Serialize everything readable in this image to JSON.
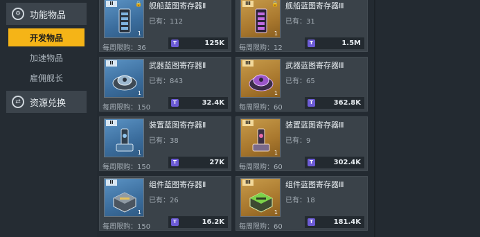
{
  "sidebar": {
    "cat1": {
      "label": "功能物品",
      "icon": "settings-circle-icon"
    },
    "sub1": "开发物品",
    "sub2": "加速物品",
    "sub3": "雇佣舰长",
    "cat2": {
      "label": "资源兑换",
      "icon": "exchange-circle-icon"
    }
  },
  "currency_symbol": "T",
  "items": [
    {
      "tier": "II",
      "name": "舰船蓝图寄存器Ⅱ",
      "owned": "已有：112",
      "limit": "每周限购：36",
      "price": "125K",
      "qty": "1",
      "color": "blue"
    },
    {
      "tier": "III",
      "name": "舰船蓝图寄存器Ⅲ",
      "owned": "已有：31",
      "limit": "每周限购：12",
      "price": "1.5M",
      "qty": "1",
      "color": "gold"
    },
    {
      "tier": "II",
      "name": "武器蓝图寄存器Ⅱ",
      "owned": "已有：843",
      "limit": "每周限购：150",
      "price": "32.4K",
      "qty": "1",
      "color": "blue"
    },
    {
      "tier": "III",
      "name": "武器蓝图寄存器Ⅲ",
      "owned": "已有：65",
      "limit": "每周限购：60",
      "price": "362.8K",
      "qty": "1",
      "color": "gold"
    },
    {
      "tier": "II",
      "name": "装置蓝图寄存器Ⅱ",
      "owned": "已有：38",
      "limit": "每周限购：150",
      "price": "27K",
      "qty": "1",
      "color": "blue"
    },
    {
      "tier": "III",
      "name": "装置蓝图寄存器Ⅲ",
      "owned": "已有：9",
      "limit": "每周限购：60",
      "price": "302.4K",
      "qty": "1",
      "color": "gold"
    },
    {
      "tier": "II",
      "name": "组件蓝图寄存器Ⅱ",
      "owned": "已有：26",
      "limit": "每周限购：150",
      "price": "16.2K",
      "qty": "1",
      "color": "blue"
    },
    {
      "tier": "III",
      "name": "组件蓝图寄存器Ⅲ",
      "owned": "已有：18",
      "limit": "每周限购：60",
      "price": "181.4K",
      "qty": "1",
      "color": "gold"
    }
  ]
}
